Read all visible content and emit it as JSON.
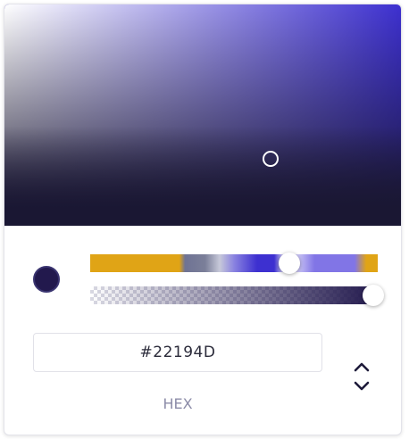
{
  "color_picker": {
    "saturation_value": {
      "hue_color": "#3d30d0"
    },
    "current_color": "#22194D",
    "hue": {
      "value_fraction": 0.66
    },
    "alpha": {
      "value_fraction": 1.0
    },
    "hex_input": {
      "value": "#22194D"
    },
    "mode_label": "HEX",
    "icons": {
      "mode_toggle": "up-down-chevron-icon"
    },
    "colors": {
      "accent_gold": "#e0a416",
      "accent_violet": "#8175e6",
      "label_gray": "#8c8ca8"
    }
  }
}
